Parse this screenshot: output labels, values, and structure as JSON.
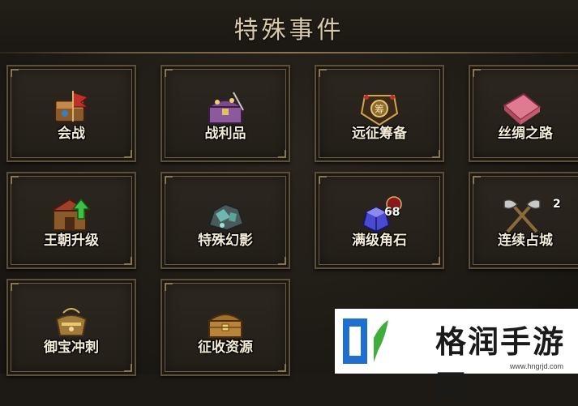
{
  "header": {
    "title": "特殊事件"
  },
  "events": [
    {
      "label": "会战",
      "icon": "war-banner-icon",
      "badge": ""
    },
    {
      "label": "战利品",
      "icon": "treasure-chest-icon",
      "badge": ""
    },
    {
      "label": "远征筹备",
      "icon": "expedition-emblem-icon",
      "badge": ""
    },
    {
      "label": "丝绸之路",
      "icon": "silk-bolt-icon",
      "badge": ""
    },
    {
      "label": "王朝升级",
      "icon": "dynasty-upgrade-icon",
      "badge": ""
    },
    {
      "label": "特殊幻影",
      "icon": "phantom-ore-icon",
      "badge": ""
    },
    {
      "label": "满级角石",
      "icon": "crystal-stone-icon",
      "badge": "68"
    },
    {
      "label": "连续占城",
      "icon": "crossed-axes-icon",
      "badge": "2"
    },
    {
      "label": "御宝冲刺",
      "icon": "golden-cauldron-icon",
      "badge": ""
    },
    {
      "label": "征收资源",
      "icon": "resource-chest-icon",
      "badge": ""
    }
  ],
  "watermark": {
    "brand": "格润手游网",
    "url": "www.hngrjd.com"
  },
  "colors": {
    "title": "#d8c9a8",
    "tile_border": "#5d503a",
    "label": "#f4ecd6"
  }
}
